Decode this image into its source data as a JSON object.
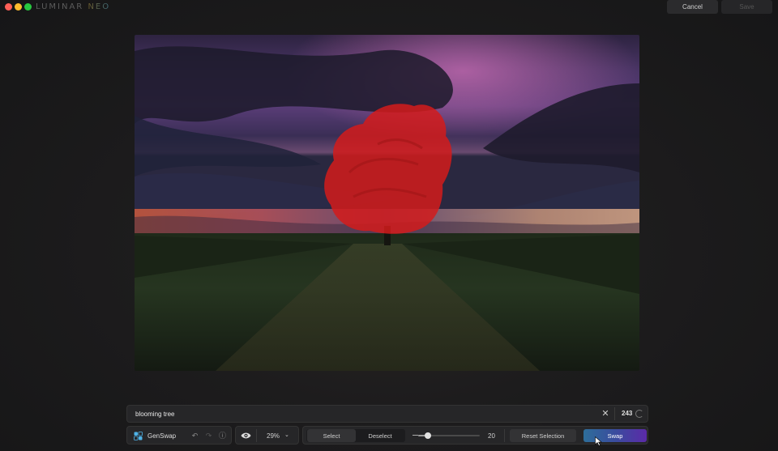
{
  "app": {
    "logo_text": "LUMINAR",
    "logo_accent": "NEO"
  },
  "header": {
    "cancel_label": "Cancel",
    "save_label": "Save"
  },
  "prompt": {
    "value": "blooming tree",
    "count": "243"
  },
  "toolbar": {
    "tool_name": "GenSwap",
    "zoom": "29%",
    "select_label": "Select",
    "deselect_label": "Deselect",
    "brush_size": "20",
    "brush_level": 0.16,
    "reset_label": "Reset Selection",
    "swap_label": "Swap"
  },
  "colors": {
    "accent_gradient_start": "#2e6e9a",
    "accent_gradient_end": "#5b2aa8",
    "mask_red": "#d41b1b"
  },
  "icons": {
    "clear": "close-icon",
    "tool": "genswap-icon",
    "undo": "undo-icon",
    "redo": "redo-icon",
    "info": "info-icon",
    "visibility": "eye-icon",
    "zoom": "chevron-down-icon"
  }
}
